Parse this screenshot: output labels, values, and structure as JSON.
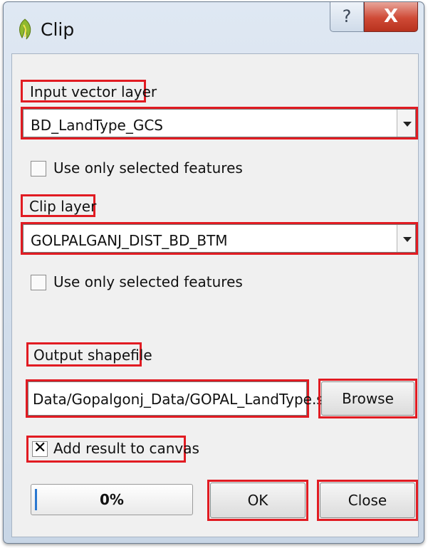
{
  "window": {
    "title": "Clip",
    "help_glyph": "?",
    "close_glyph": "X"
  },
  "input_layer": {
    "label": "Input vector layer",
    "selected": "BD_LandType_GCS",
    "selected_only_label": "Use only selected features",
    "selected_only_checked": false
  },
  "clip_layer": {
    "label": "Clip layer",
    "selected": "GOLPALGANJ_DIST_BD_BTM",
    "selected_only_label": "Use only selected features",
    "selected_only_checked": false
  },
  "output": {
    "label": "Output shapefile",
    "path": "Data/Gopalgonj_Data/GOPAL_LandType.shp",
    "browse_label": "Browse",
    "add_to_canvas_label": "Add result to canvas",
    "add_to_canvas_checked": true
  },
  "footer": {
    "progress_text": "0%",
    "progress_value": 0,
    "ok_label": "OK",
    "close_label": "Close"
  },
  "colors": {
    "highlight": "#e11b22",
    "progress_accent": "#2b78d0"
  },
  "icons": {
    "app": "qgis-icon",
    "help": "help-icon",
    "close": "close-icon",
    "dropdown": "chevron-down-icon",
    "check": "checkmark-icon"
  }
}
